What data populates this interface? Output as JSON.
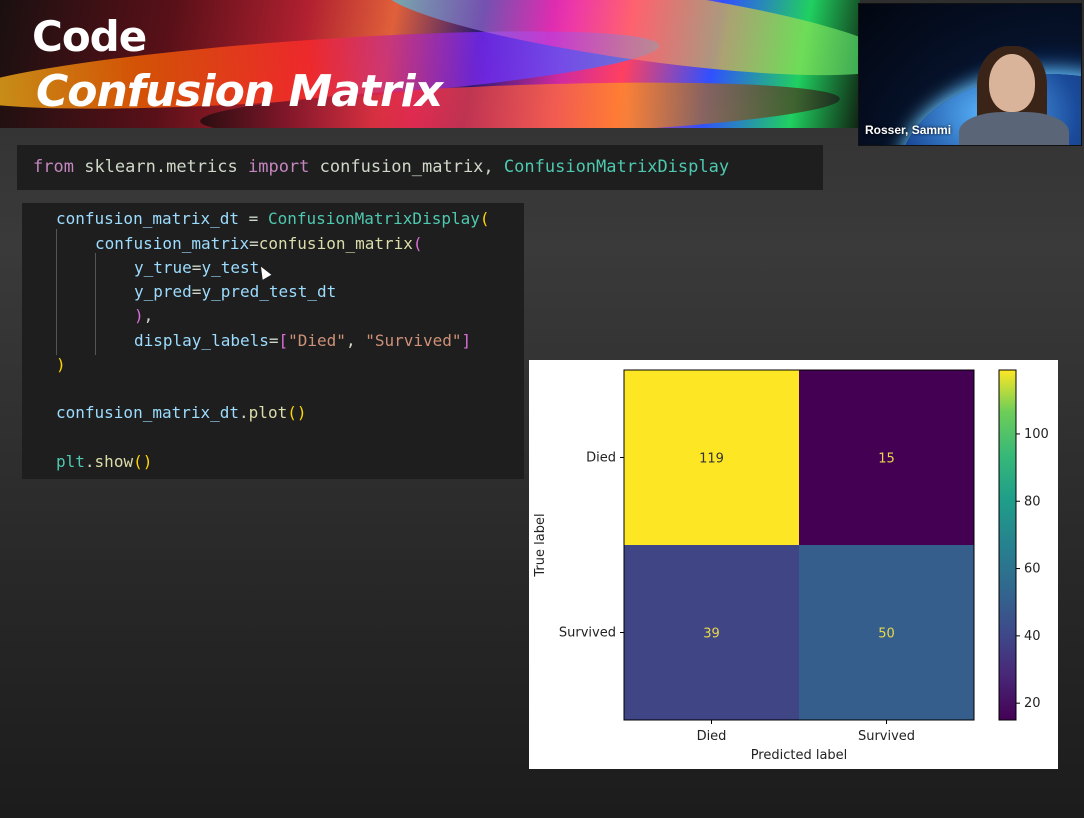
{
  "slide": {
    "title_line1": "Code",
    "title_line2": "Confusion Matrix"
  },
  "video": {
    "participant_name": "Rosser, Sammi"
  },
  "import_code": {
    "kw_from": "from",
    "module": "sklearn.metrics",
    "kw_import": "import",
    "fn1": "confusion_matrix",
    "comma": ",",
    "cls": "ConfusionMatrixDisplay"
  },
  "code": {
    "l1_var": "confusion_matrix_dt",
    "l1_eq": " = ",
    "l1_cls": "ConfusionMatrixDisplay",
    "l1_paren": "(",
    "l2_arg": "confusion_matrix",
    "l2_eq": "=",
    "l2_fn": "confusion_matrix",
    "l2_paren": "(",
    "l3_arg": "y_true",
    "l3_eq": "=",
    "l3_val": "y_test",
    "l4_arg": "y_pred",
    "l4_eq": "=",
    "l4_val": "y_pred_test_dt",
    "l5_close": ")",
    "l5_comma": ",",
    "l6_arg": "display_labels",
    "l6_eq": "=",
    "l6_open": "[",
    "l6_s1": "\"Died\"",
    "l6_sep": ", ",
    "l6_s2": "\"Survived\"",
    "l6_close": "]",
    "l7_close": ")",
    "l8_var": "confusion_matrix_dt",
    "l8_dot": ".",
    "l8_fn": "plot",
    "l8_paren": "()",
    "l9_var": "plt",
    "l9_dot": ".",
    "l9_fn": "show",
    "l9_paren": "()"
  },
  "chart_data": {
    "type": "heatmap",
    "rows": [
      "Died",
      "Survived"
    ],
    "columns": [
      "Died",
      "Survived"
    ],
    "values": [
      [
        119,
        15
      ],
      [
        39,
        50
      ]
    ],
    "xlabel": "Predicted label",
    "ylabel": "True label",
    "colorbar": {
      "ticks": [
        20,
        40,
        60,
        80,
        100
      ],
      "range": [
        15,
        119
      ],
      "colormap": "viridis"
    }
  }
}
